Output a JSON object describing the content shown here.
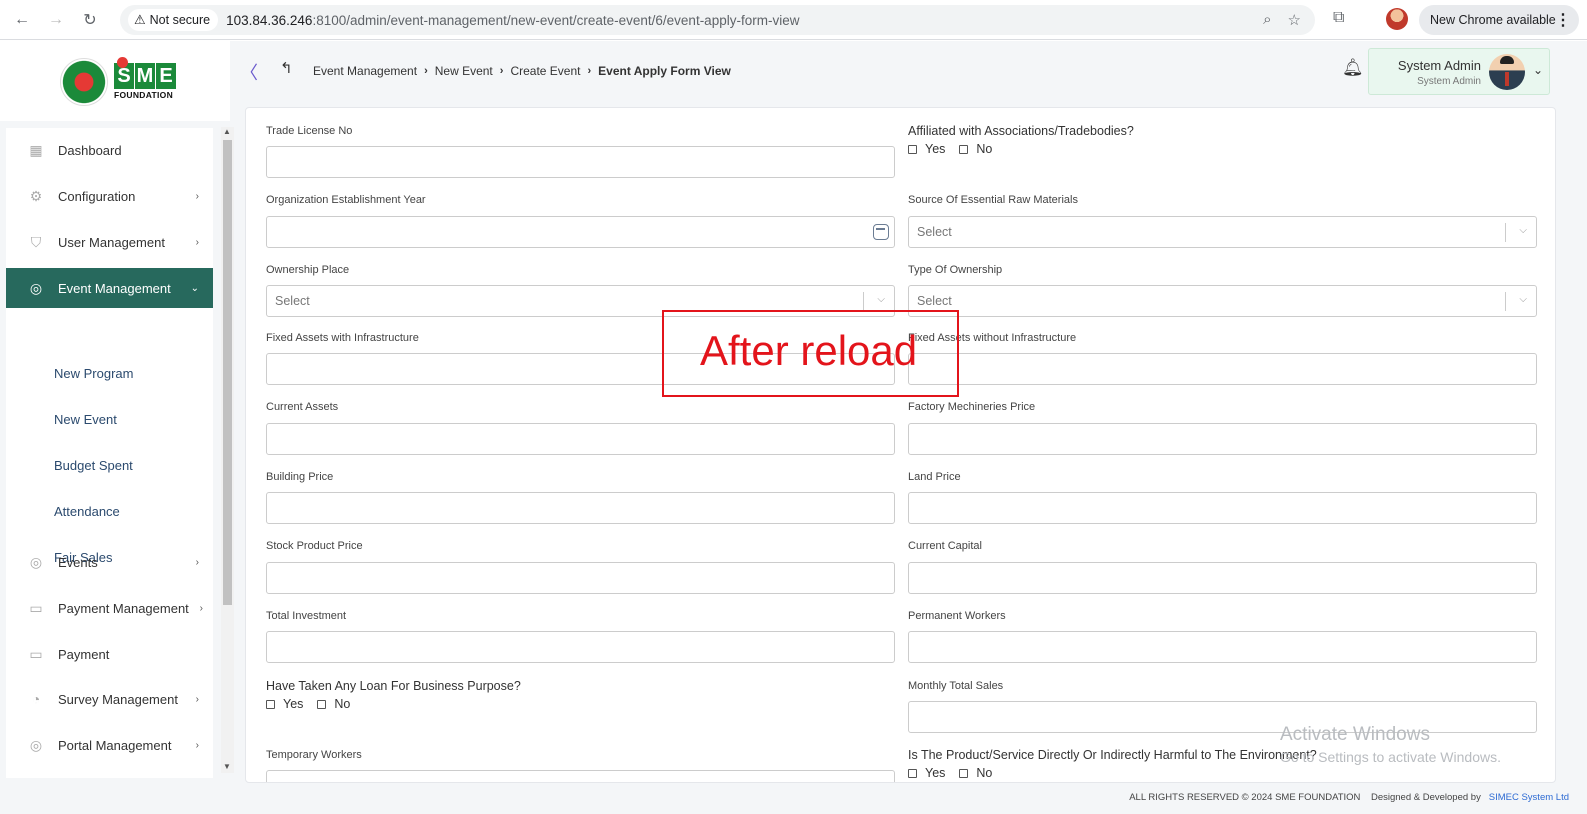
{
  "browser": {
    "security_label": "Not secure",
    "url_host": "103.84.36.246",
    "url_rest": ":8100/admin/event-management/new-event/create-event/6/event-apply-form-view",
    "update_label": "New Chrome available"
  },
  "logo": {
    "letters": [
      "S",
      "M",
      "E"
    ],
    "sub": "FOUNDATION"
  },
  "breadcrumb": [
    "Event Management",
    "New Event",
    "Create Event",
    "Event Apply Form View"
  ],
  "user": {
    "name": "System Admin",
    "role": "System Admin"
  },
  "sidebar": {
    "items": [
      {
        "label": "Dashboard",
        "icon": "grid-icon"
      },
      {
        "label": "Configuration",
        "icon": "config-icon",
        "chevron": "›"
      },
      {
        "label": "User Management",
        "icon": "shield-icon",
        "chevron": "›"
      },
      {
        "label": "Event Management",
        "icon": "lock-circle-icon",
        "chevron": "⌄",
        "active": true
      },
      {
        "label": "Events",
        "icon": "lock-circle-icon",
        "chevron": "›"
      },
      {
        "label": "Payment Management",
        "icon": "cash-icon",
        "chevron": "›"
      },
      {
        "label": "Payment",
        "icon": "cash-icon"
      },
      {
        "label": "Survey Management",
        "icon": "pie-icon",
        "chevron": "›"
      },
      {
        "label": "Portal Management",
        "icon": "lock-circle-icon",
        "chevron": "›"
      }
    ],
    "sub_items": [
      "New Program",
      "New Event",
      "Budget Spent",
      "Attendance",
      "Fair Sales"
    ]
  },
  "form": {
    "trade_license": "Trade License No",
    "affiliated": "Affiliated with Associations/Tradebodies?",
    "yes": "Yes",
    "no": "No",
    "establishment_year": "Organization Establishment Year",
    "raw_materials": "Source Of Essential Raw Materials",
    "select_placeholder": "Select",
    "ownership_place": "Ownership Place",
    "type_of_ownership": "Type Of Ownership",
    "fixed_with": "Fixed Assets with Infrastructure",
    "fixed_without": "Fixed Assets without Infrastructure",
    "current_assets": "Current Assets",
    "factory_price": "Factory Mechineries Price",
    "building_price": "Building Price",
    "land_price": "Land Price",
    "stock_price": "Stock Product Price",
    "current_capital": "Current Capital",
    "total_investment": "Total Investment",
    "permanent_workers": "Permanent Workers",
    "loan_question": "Have Taken Any Loan For Business Purpose?",
    "monthly_sales": "Monthly Total Sales",
    "temporary_workers": "Temporary Workers",
    "harmful_question": "Is The Product/Service Directly Or Indirectly Harmful to The Environment?"
  },
  "annotation": "After reload",
  "watermark": {
    "line1": "Activate Windows",
    "line2": "Go to Settings to activate Windows."
  },
  "footer": {
    "rights": "ALL RIGHTS RESERVED © 2024 SME FOUNDATION",
    "designed": "Designed & Developed by",
    "company": "SIMEC System Ltd"
  },
  "colors": {
    "sidebar_active": "#27695d",
    "annotation": "#e3141b",
    "link": "#2e6bd3"
  }
}
